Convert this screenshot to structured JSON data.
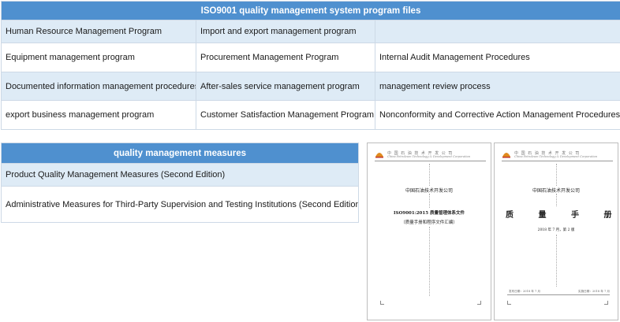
{
  "top_table": {
    "title": "ISO9001 quality management system program files",
    "rows": [
      [
        "Human Resource Management Program",
        "Import and export management program",
        ""
      ],
      [
        "Equipment management program",
        "Procurement Management Program",
        "Internal Audit Management Procedures"
      ],
      [
        "Documented information management procedures",
        "After-sales service management program",
        "management review process"
      ],
      [
        "export business management program",
        "Customer Satisfaction Management Program",
        "Nonconformity and Corrective Action Management Procedures"
      ]
    ]
  },
  "measures_table": {
    "title": "quality management measures",
    "rows": [
      "Product Quality Management Measures (Second Edition)",
      "Administrative Measures for Third-Party Supervision and Testing Institutions (Second Edition)"
    ]
  },
  "doc_left": {
    "org_cn": "中 国 石 油 技 术 开 发 公 司",
    "org_en": "China Petroleum Technology & Development Corporation",
    "company": "中国石油技术开发公司",
    "title": "ISO9001:2015 质量管理体系文件",
    "subtitle": "（质量手册和程序文件汇编）"
  },
  "doc_right": {
    "org_cn": "中 国 石 油 技 术 开 发 公 司",
    "org_en": "China Petroleum Technology & Development Corporation",
    "company": "中国石油技术开发公司",
    "title": "质 量 手 册",
    "edition": "2018 年 7 月，第 2 版",
    "footer_left": "发布日期：2018 年 7 月",
    "footer_right": "实施日期：2018 年 7 月"
  },
  "colors": {
    "header": "#4f90cf",
    "row_shade": "#deebf6",
    "border": "#cdd9e6"
  }
}
